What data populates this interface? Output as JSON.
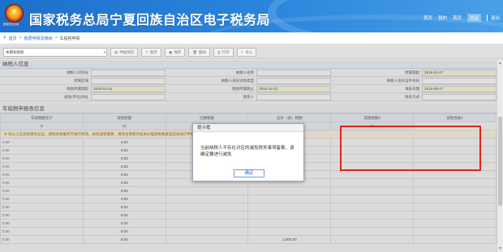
{
  "header": {
    "logo_caption": "国家税务总局",
    "title": "国家税务总局宁夏回族自治区电子税务局",
    "nav": [
      "首页",
      "我的",
      "首页",
      "欢迎"
    ],
    "active_index": 3,
    "logout": "退出"
  },
  "breadcrumb": {
    "home": "首页",
    "sep": ">",
    "item": "税费申报及缴纳",
    "sep2": ">",
    "current": "车船税申报"
  },
  "toolbar": {
    "select_value": "本期有税款",
    "buttons": [
      "申报预览",
      "暂存",
      "保存",
      "删除",
      "打印",
      "导入"
    ]
  },
  "section1": {
    "title": "纳税人信息",
    "rows": [
      [
        {
          "label": "纳税人识别号",
          "value": ""
        },
        {
          "label": "纳税人名称",
          "value": ""
        },
        {
          "label": "所属期起",
          "value": "2018-01-07"
        }
      ],
      [
        {
          "label": "所属区域",
          "value": ""
        },
        {
          "label": "纳税人身份识别类型",
          "value": ""
        },
        {
          "label": "纳税人身份证件号码",
          "value": ""
        }
      ],
      [
        {
          "label": "税款所属期起",
          "value": "2018-01-01"
        },
        {
          "label": "税款所属期止",
          "value": "2018-12-31"
        },
        {
          "label": "填表日期",
          "value": "2018-08-07"
        }
      ],
      [
        {
          "label": "居住(单位)地址",
          "value": ""
        },
        {
          "label": "联系人",
          "value": ""
        },
        {
          "label": "联系方式",
          "value": ""
        }
      ]
    ]
  },
  "section2": {
    "title": "车船税申报表信息",
    "headers": [
      "车船税额合计",
      "减免税额",
      "已缴税额",
      "应补（退）税额",
      "减免税额2",
      "减免性质2"
    ],
    "header_row2": [
      "9",
      "10",
      "11",
      "12",
      "13"
    ],
    "note": "※ 对以上信息如果有异议，请到办税服务厅进行修改，如有减免需要，请到主管税务机关办理减免税备案后再进行申报，减免信息仅供参考（按年计算后）",
    "rows": [
      [
        "0.00",
        "0.00",
        "",
        "",
        "",
        ""
      ],
      [
        "0.00",
        "0.00",
        "",
        "",
        "",
        ""
      ],
      [
        "0.00",
        "0.00",
        "",
        "",
        "",
        ""
      ],
      [
        "0.00",
        "0.00",
        "",
        "",
        "",
        ""
      ],
      [
        "0.00",
        "0.00",
        "",
        "",
        "",
        ""
      ],
      [
        "0.00",
        "0.00",
        "",
        "",
        "",
        ""
      ],
      [
        "0.00",
        "0.00",
        "",
        "",
        "",
        ""
      ],
      [
        "0.00",
        "0.00",
        "",
        "",
        "",
        ""
      ],
      [
        "0.00",
        "0.00",
        "",
        "",
        "",
        ""
      ],
      [
        "0.00",
        "0.00",
        "",
        "",
        "",
        ""
      ],
      [
        "0.00",
        "0.00",
        "",
        "",
        "",
        ""
      ],
      [
        "0.00",
        "0.00",
        "",
        "",
        "",
        ""
      ]
    ],
    "total_row": [
      "0.00",
      "0.00",
      "",
      "2,000.00",
      "",
      ""
    ]
  },
  "dialog": {
    "title": "提示框",
    "message": "当前纳税人不存在对应的减免税务事项备案，请确定要进行减免",
    "ok_label": "确定"
  },
  "colors": {
    "header_blue": "#2b86dd",
    "highlight_red": "#d9261c",
    "link_blue": "#2b6fc8"
  }
}
